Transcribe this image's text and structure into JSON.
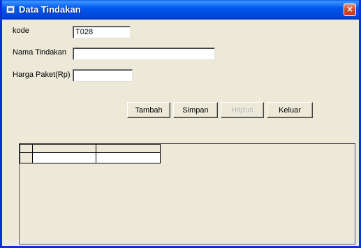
{
  "window": {
    "title": "Data Tindakan",
    "close_glyph": "×",
    "icon": "app-form-icon"
  },
  "form": {
    "kode_label": "kode",
    "kode_value": "T028",
    "nama_label": "Nama Tindakan",
    "nama_value": "",
    "harga_label": "Harga Paket(Rp)",
    "harga_value": ""
  },
  "buttons": {
    "tambah": "Tambah",
    "simpan": "Simpan",
    "hapus": "Hapus",
    "keluar": "Keluar"
  },
  "grid": {
    "columns": 3,
    "rows": 1,
    "cells": []
  },
  "colors": {
    "titlebar": "#0058ee",
    "window_bg": "#ece9d8",
    "close_button": "#d4492a"
  }
}
